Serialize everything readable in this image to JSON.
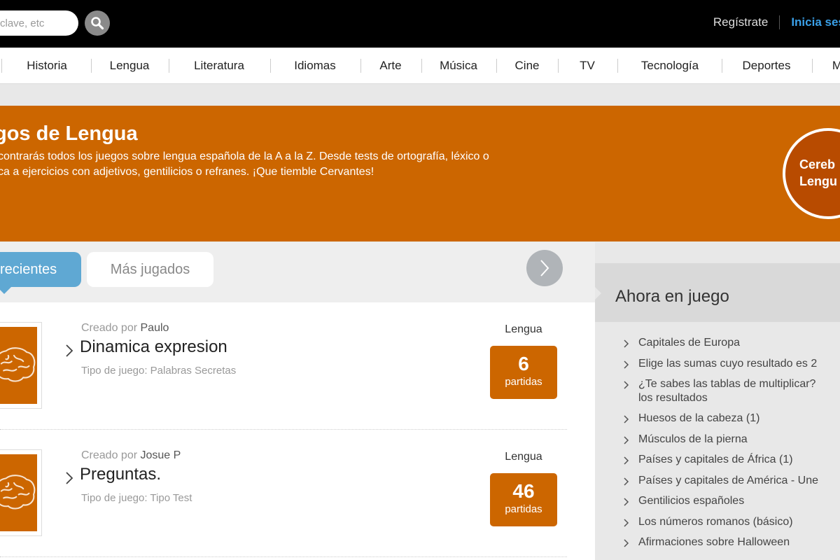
{
  "search": {
    "placeholder": "clave, etc"
  },
  "auth": {
    "register": "Regístrate",
    "login": "Inicia sesió"
  },
  "nav": {
    "items": [
      "Historia",
      "Lengua",
      "Literatura",
      "Idiomas",
      "Arte",
      "Música",
      "Cine",
      "TV",
      "Tecnología",
      "Deportes",
      "M"
    ]
  },
  "hero": {
    "title": "gos de Lengua",
    "desc_line1": "contrarás todos los juegos sobre lengua española de la A a la Z. Desde tests de ortografía, léxico o",
    "desc_line2": "ca a ejercicios con adjetivos, gentilicios o refranes. ¡Que tiemble Cervantes!",
    "badge_line1": "Cereb",
    "badge_line2": "Lengu"
  },
  "tabs": {
    "active": "recientes",
    "other": "Más jugados"
  },
  "games": [
    {
      "created_by": "Creado por",
      "author": "Paulo",
      "title": "Dinamica expresion",
      "type": "Tipo de juego: Palabras Secretas",
      "category": "Lengua",
      "plays": "6",
      "plays_label": "partidas"
    },
    {
      "created_by": "Creado por",
      "author": "Josue P",
      "title": "Preguntas.",
      "type": "Tipo de juego: Tipo Test",
      "category": "Lengua",
      "plays": "46",
      "plays_label": "partidas"
    }
  ],
  "sidebar": {
    "title": "Ahora en juego",
    "items": [
      {
        "line1": "Capitales de Europa"
      },
      {
        "line1": "Elige las sumas cuyo resultado es 2"
      },
      {
        "line1": "¿Te sabes las tablas de multiplicar?",
        "line2": "los resultados"
      },
      {
        "line1": "Huesos de la cabeza (1)"
      },
      {
        "line1": "Músculos de la pierna"
      },
      {
        "line1": "Países y capitales de África (1)"
      },
      {
        "line1": "Países y capitales de América - Une"
      },
      {
        "line1": "Gentilicios españoles"
      },
      {
        "line1": "Los números romanos (básico)"
      },
      {
        "line1": "Afirmaciones sobre Halloween"
      }
    ]
  },
  "colors": {
    "topbar": "#000000",
    "accent_orange": "#cc6600",
    "tab_blue": "#5fa8d3",
    "link_blue": "#3aa0e8"
  },
  "icons": {
    "search": "magnifier-icon",
    "next": "chevron-right-icon",
    "thumb": "brain-icon"
  }
}
